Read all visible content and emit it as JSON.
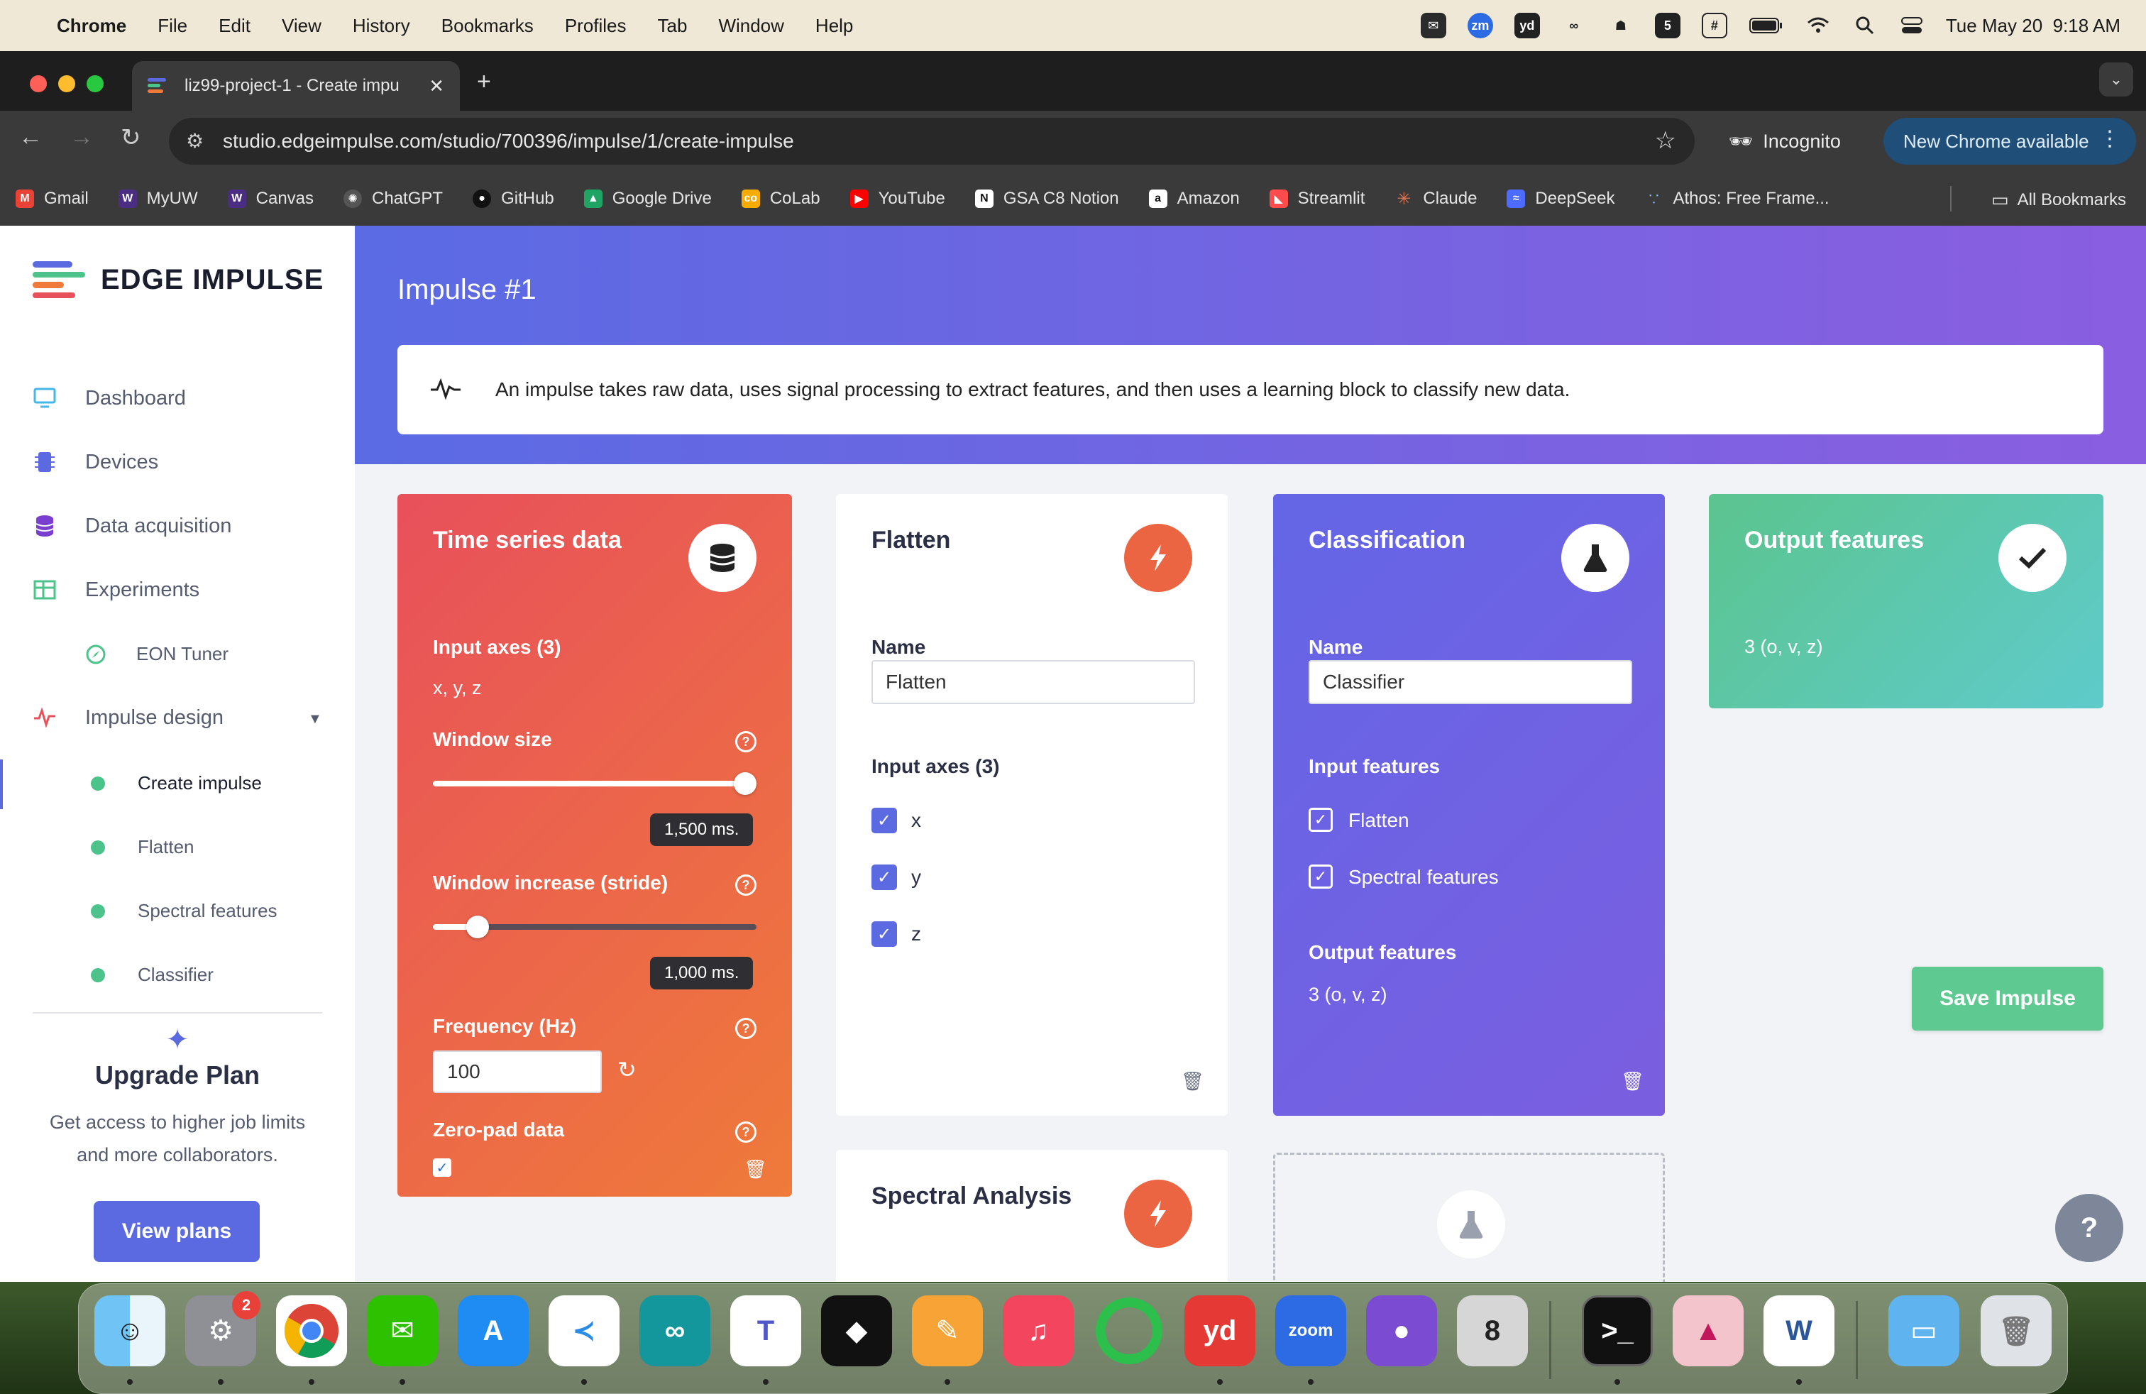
{
  "menubar": {
    "app": "Chrome",
    "items": [
      "File",
      "Edit",
      "View",
      "History",
      "Bookmarks",
      "Profiles",
      "Tab",
      "Window",
      "Help"
    ],
    "clock": "Tue May 20  9:18 AM",
    "status_icons": [
      "wechat-icon",
      "zoom-icon",
      "youdao-icon",
      "creative-cloud-icon",
      "teams-icon",
      "five-icon",
      "input-method-icon",
      "battery-icon",
      "wifi-icon",
      "spotlight-icon",
      "control-center-icon"
    ]
  },
  "browser": {
    "tab_title": "liz99-project-1 - Create impu",
    "url": "studio.edgeimpulse.com/studio/700396/impulse/1/create-impulse",
    "incognito_label": "Incognito",
    "new_chrome_label": "New Chrome available",
    "bookmarks": [
      "Gmail",
      "MyUW",
      "Canvas",
      "ChatGPT",
      "GitHub",
      "Google Drive",
      "CoLab",
      "YouTube",
      "GSA C8 Notion",
      "Amazon",
      "Streamlit",
      "Claude",
      "DeepSeek",
      "Athos: Free Frame..."
    ],
    "all_bookmarks": "All Bookmarks"
  },
  "sidebar": {
    "brand": "EDGE IMPULSE",
    "nav": [
      {
        "label": "Dashboard",
        "icon": "monitor-icon"
      },
      {
        "label": "Devices",
        "icon": "chip-icon"
      },
      {
        "label": "Data acquisition",
        "icon": "database-icon"
      },
      {
        "label": "Experiments",
        "icon": "table-icon"
      }
    ],
    "eon_tuner": "EON Tuner",
    "impulse_design": "Impulse design",
    "subitems": [
      "Create impulse",
      "Flatten",
      "Spectral features",
      "Classifier"
    ],
    "upgrade": {
      "title": "Upgrade Plan",
      "desc": "Get access to higher job limits and more collaborators.",
      "button": "View plans"
    }
  },
  "main": {
    "title": "Impulse #1",
    "info": "An impulse takes raw data, uses signal processing to extract features, and then uses a learning block to classify new data.",
    "time_series": {
      "title": "Time series data",
      "input_axes_label": "Input axes (3)",
      "input_axes_value": "x, y, z",
      "window_size_label": "Window size",
      "window_size_value": "1,500 ms.",
      "window_size_fraction": 1.0,
      "window_increase_label": "Window increase (stride)",
      "window_increase_value": "1,000 ms.",
      "window_increase_fraction": 0.11,
      "frequency_label": "Frequency (Hz)",
      "frequency_value": "100",
      "zero_pad_label": "Zero-pad data",
      "zero_pad_checked": true
    },
    "flatten": {
      "title": "Flatten",
      "name_label": "Name",
      "name_value": "Flatten",
      "input_axes_label": "Input axes (3)",
      "axes": [
        "x",
        "y",
        "z"
      ]
    },
    "spectral": {
      "title": "Spectral Analysis"
    },
    "classification": {
      "title": "Classification",
      "name_label": "Name",
      "name_value": "Classifier",
      "input_features_label": "Input features",
      "input_features": [
        "Flatten",
        "Spectral features"
      ],
      "output_features_label": "Output features",
      "output_features_value": "3 (o, v, z)"
    },
    "output": {
      "title": "Output features",
      "value": "3 (o, v, z)"
    },
    "save_button": "Save Impulse"
  },
  "colors": {
    "time_series_start": "#e8505b",
    "time_series_end": "#ef7a3a",
    "classification": "#6366e6",
    "output_start": "#5cc48e",
    "output_end": "#5ecbcb",
    "accent": "#5b6ae0",
    "dsp_icon": "#ec6542"
  },
  "dock": {
    "system_settings_badge": "2",
    "apps": [
      "finder-icon",
      "system-settings-icon",
      "chrome-icon",
      "wechat-icon",
      "app-store-icon",
      "vscode-icon",
      "arduino-icon",
      "teams-icon",
      "cube-icon",
      "pages-icon",
      "music-icon",
      "circle-app-icon",
      "youdao-icon",
      "zoom-icon",
      "github-desktop-icon",
      "rhino-icon",
      "terminal-icon",
      "affinity-icon",
      "word-icon",
      "folder-icon",
      "trash-icon"
    ]
  }
}
